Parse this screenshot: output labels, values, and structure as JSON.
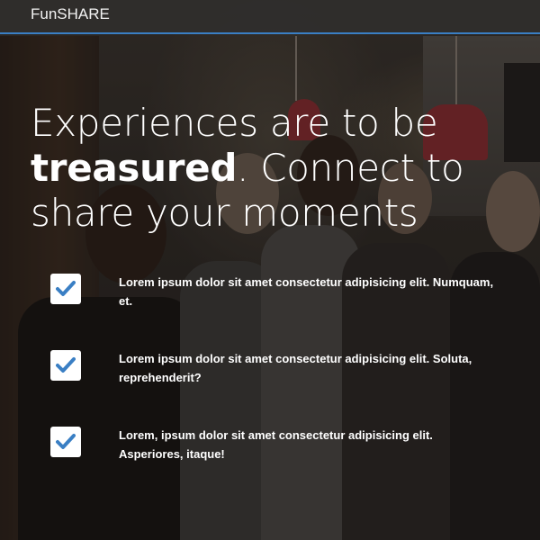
{
  "navbar": {
    "brand": "FunSHARE",
    "accent_color": "#3a7fc4"
  },
  "hero": {
    "headline_part1": "Experiences are to be ",
    "headline_bold": "treasured",
    "headline_part2": ". Connect to share your moments"
  },
  "features": [
    {
      "icon": "checkbox-checked-icon",
      "text": "Lorem ipsum dolor sit amet consectetur adipisicing elit. Numquam, et."
    },
    {
      "icon": "checkbox-checked-icon",
      "text": "Lorem ipsum dolor sit amet consectetur adipisicing elit. Soluta, reprehenderit?"
    },
    {
      "icon": "checkbox-checked-icon",
      "text": "Lorem, ipsum dolor sit amet consectetur adipisicing elit. Asperiores, itaque!"
    }
  ],
  "colors": {
    "check_color": "#3a7fc4",
    "text_color": "#ffffff"
  }
}
